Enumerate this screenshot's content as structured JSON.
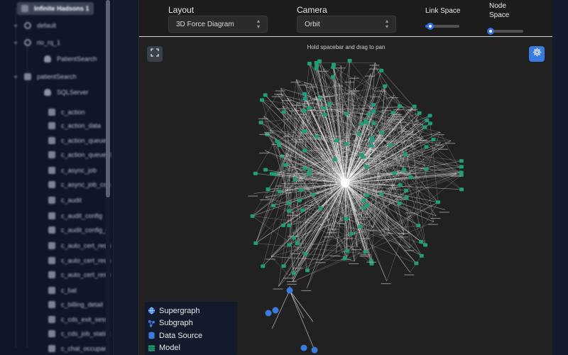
{
  "sidebar": {
    "items": [
      {
        "label": "Infinite Hadsons 1",
        "kind": "super",
        "depth": 0,
        "selected": true
      },
      {
        "label": "default",
        "kind": "sub",
        "depth": 1
      },
      {
        "label": "rio_rq_1",
        "kind": "sub",
        "depth": 1
      },
      {
        "label": "PatientSearch",
        "kind": "db",
        "depth": 2
      },
      {
        "label": "patientSearch",
        "kind": "search",
        "depth": 1
      },
      {
        "label": "SQLServer",
        "kind": "db",
        "depth": 2
      },
      {
        "label": "c_action",
        "kind": "model",
        "depth": 2
      },
      {
        "label": "c_action_data",
        "kind": "model",
        "depth": 2
      },
      {
        "label": "c_action_queue",
        "kind": "model",
        "depth": 2
      },
      {
        "label": "c_action_queue_l",
        "kind": "model",
        "depth": 2
      },
      {
        "label": "c_async_job",
        "kind": "model",
        "depth": 2
      },
      {
        "label": "c_async_job_con",
        "kind": "model",
        "depth": 2
      },
      {
        "label": "c_audit",
        "kind": "model",
        "depth": 2
      },
      {
        "label": "c_audit_config",
        "kind": "model",
        "depth": 2
      },
      {
        "label": "c_audit_config_n",
        "kind": "model",
        "depth": 2
      },
      {
        "label": "c_auto_cert_requ",
        "kind": "model",
        "depth": 2
      },
      {
        "label": "c_auto_cert_requ",
        "kind": "model",
        "depth": 2
      },
      {
        "label": "c_auto_cert_resp",
        "kind": "model",
        "depth": 2
      },
      {
        "label": "c_bat",
        "kind": "model",
        "depth": 2
      },
      {
        "label": "c_billing_detail",
        "kind": "model",
        "depth": 2
      },
      {
        "label": "c_cds_exit_sessi",
        "kind": "model",
        "depth": 2
      },
      {
        "label": "c_cds_job_statist",
        "kind": "model",
        "depth": 2
      },
      {
        "label": "c_chat_occupan",
        "kind": "model",
        "depth": 2
      }
    ]
  },
  "controls": {
    "layout_label": "Layout",
    "layout_value": "3D Force Diagram",
    "camera_label": "Camera",
    "camera_value": "Orbit",
    "link_space_label": "Link Space",
    "link_space_value": 0.15,
    "node_space_label_line1": "Node",
    "node_space_label_line2": "Space",
    "node_space_value": 0.05
  },
  "canvas": {
    "hint": "Hold spacebar and drag to pan",
    "fullscreen_icon": "expand-icon",
    "settings_icon": "gear-icon"
  },
  "legend": {
    "items": [
      {
        "label": "Supergraph",
        "icon": "globe-icon",
        "color": "#3a7be0"
      },
      {
        "label": "Subgraph",
        "icon": "subgraph-icon",
        "color": "#3a7be0"
      },
      {
        "label": "Data Source",
        "icon": "database-icon",
        "color": "#3a7be0"
      },
      {
        "label": "Model",
        "icon": "table-icon",
        "color": "#1f9e7a"
      }
    ]
  },
  "colors": {
    "accent": "#2f6fe0",
    "model_node": "#1f9e7a",
    "datasource_node": "#3a7be0",
    "edge": "#ffffff"
  }
}
